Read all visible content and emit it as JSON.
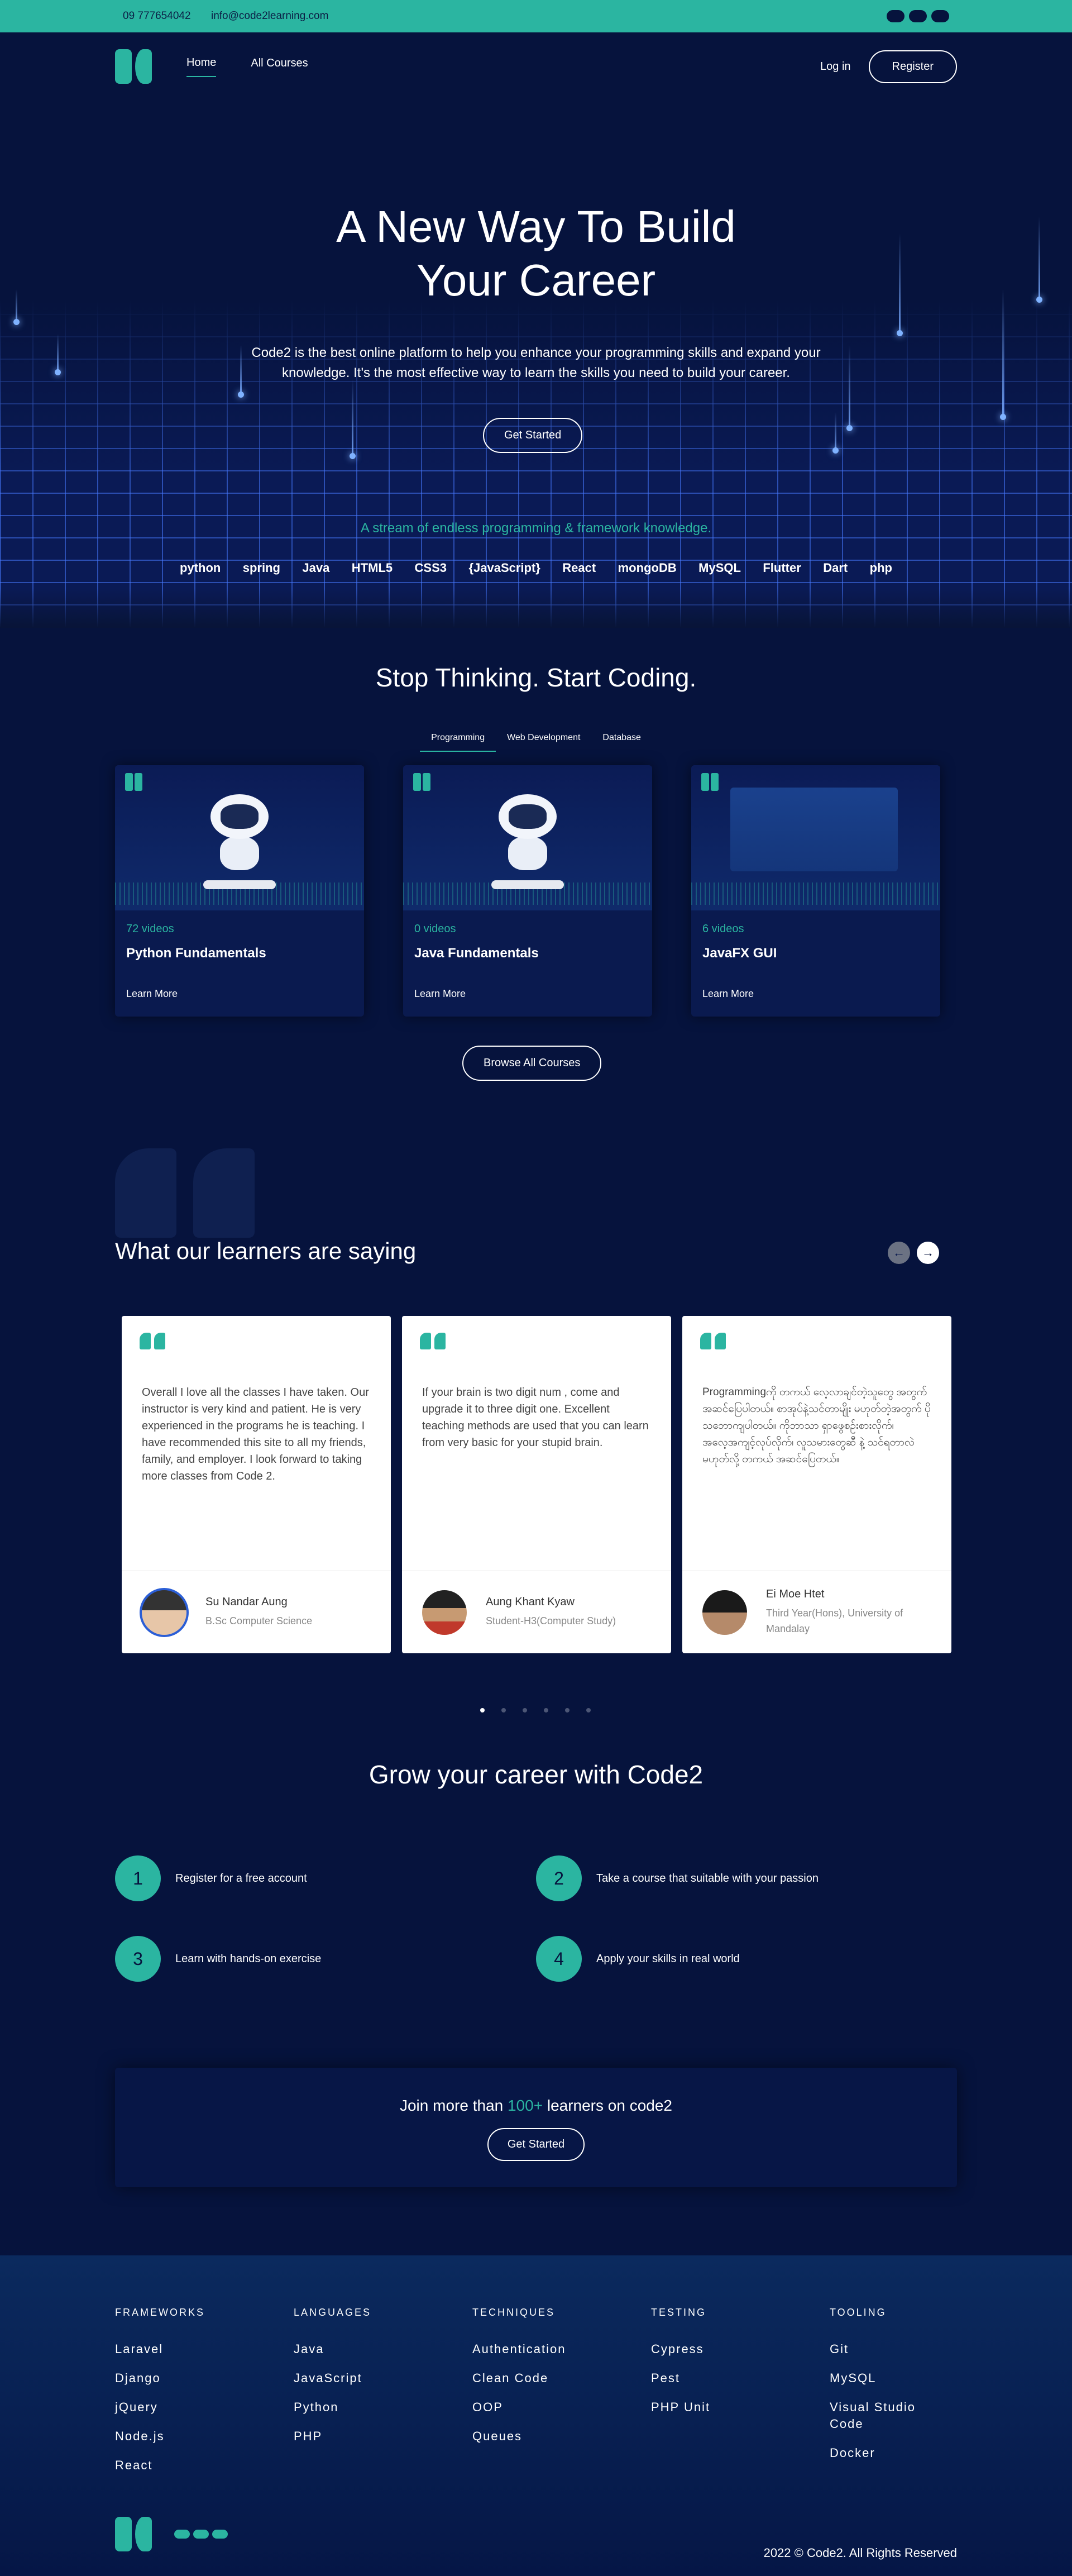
{
  "topbar": {
    "phone": "09 777654042",
    "email": "info@code2learning.com"
  },
  "nav": {
    "home": "Home",
    "courses": "All Courses",
    "login": "Log in",
    "register": "Register"
  },
  "hero": {
    "title_line1": "A New Way To Build",
    "title_line2": "Your Career",
    "subtitle": "Code2 is the best online platform to help you enhance your programming skills and expand your knowledge. It's the most effective way to learn the skills you need to build your career.",
    "cta": "Get Started",
    "stream": "A stream of endless programming & framework knowledge.",
    "techs": [
      "python",
      "spring",
      "Java",
      "HTML5",
      "CSS3",
      "{JavaScript}",
      "React",
      "mongoDB",
      "MySQL",
      "Flutter",
      "Dart",
      "php"
    ]
  },
  "courses": {
    "title": "Stop Thinking. Start Coding.",
    "tabs": [
      "Programming",
      "Web Development",
      "Database"
    ],
    "items": [
      {
        "videos": "72 videos",
        "name": "Python Fundamentals",
        "learn": "Learn More"
      },
      {
        "videos": "0 videos",
        "name": "Java Fundamentals",
        "learn": "Learn More"
      },
      {
        "videos": "6 videos",
        "name": "JavaFX GUI",
        "learn": "Learn More"
      }
    ],
    "browse": "Browse All Courses"
  },
  "testimonials": {
    "title": "What our learners are saying",
    "items": [
      {
        "text": "Overall I love all the classes I have taken. Our instructor is very kind and patient. He is very experienced in the programs he is teaching. I have recommended this site to all my friends, family, and employer. I look forward to taking more classes from Code 2.",
        "name": "Su Nandar Aung",
        "role": "B.Sc Computer Science"
      },
      {
        "text": "If your brain is two digit num , come and upgrade it to three digit one. Excellent teaching methods are used that you can learn from very basic for your stupid brain.",
        "name": "Aung Khant Kyaw",
        "role": "Student-H3(Computer Study)"
      },
      {
        "text": "Programmingကို တကယ် လေ့လာချင်တဲ့သူတွေ အတွက် အဆင်ပြေပါတယ်။ စာအုပ်နဲ့သင်တာမျိုး မဟုတ်တဲ့အတွက် ပိုသဘောကျပါတယ်။ ကိုဘာသာ ရှာဖွေစဉ်းစားလိုက်၊ အလေ့အကျင့်လုပ်လိုက်၊ လူသမားတွေဆီ နဲ့ သင်ရတာလဲ မဟုတ်လို့ တကယ် အဆင်ပြေတယ်။",
        "name": "Ei Moe Htet",
        "role": "Third Year(Hons), University of Mandalay"
      }
    ]
  },
  "grow": {
    "title": "Grow your career with Code2",
    "steps": [
      {
        "num": "1",
        "label": "Register for a free account"
      },
      {
        "num": "2",
        "label": "Take a course that suitable with your passion"
      },
      {
        "num": "3",
        "label": "Learn with hands-on exercise"
      },
      {
        "num": "4",
        "label": "Apply your skills in real world"
      }
    ]
  },
  "join": {
    "pre": "Join more than ",
    "count": "100+",
    "post": " learners on code2",
    "cta": "Get Started"
  },
  "footer": {
    "cols": [
      {
        "title": "FRAMEWORKS",
        "items": [
          "Laravel",
          "Django",
          "jQuery",
          "Node.js",
          "React"
        ]
      },
      {
        "title": "LANGUAGES",
        "items": [
          "Java",
          "JavaScript",
          "Python",
          "PHP"
        ]
      },
      {
        "title": "TECHNIQUES",
        "items": [
          "Authentication",
          "Clean Code",
          "OOP",
          "Queues"
        ]
      },
      {
        "title": "TESTING",
        "items": [
          "Cypress",
          "Pest",
          "PHP Unit"
        ]
      },
      {
        "title": "TOOLING",
        "items": [
          "Git",
          "MySQL",
          "Visual Studio Code",
          "Docker"
        ]
      }
    ],
    "copyright": "2022 © Code2. All Rights Reserved"
  },
  "colors": {
    "accent": "#2bb5a1",
    "background": "#06133d"
  }
}
